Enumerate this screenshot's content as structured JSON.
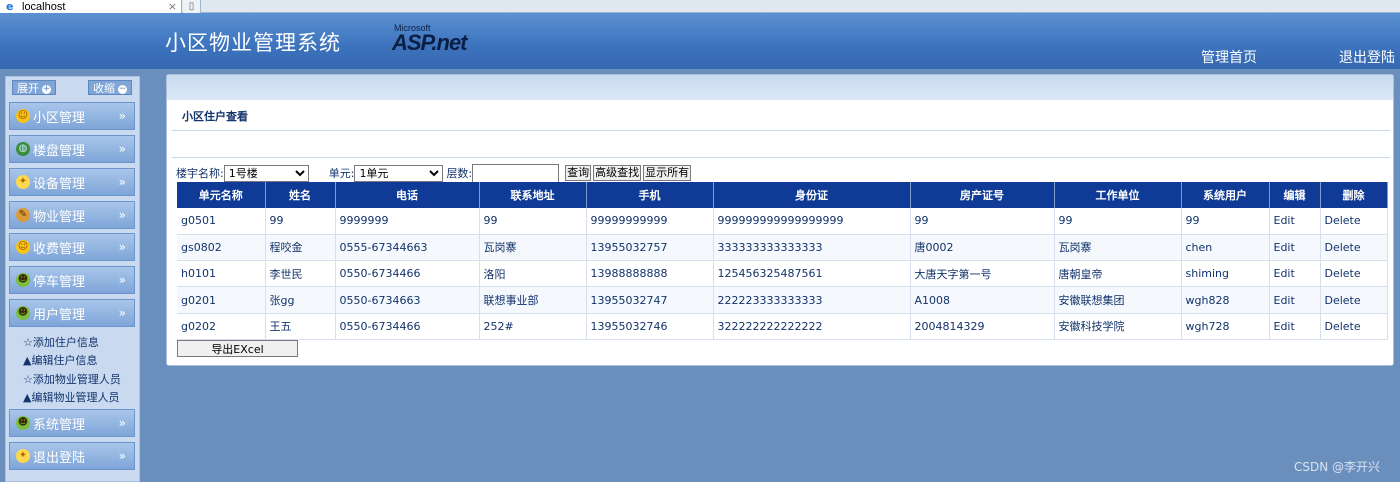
{
  "browser": {
    "tab_title": "localhost",
    "close_glyph": "×",
    "new_tab_glyph": "▯"
  },
  "header": {
    "title": "小区物业管理系统",
    "logo_small": "Microsoft",
    "logo_main": "ASP.net",
    "nav_home": "管理首页",
    "nav_logout": "退出登陆"
  },
  "sidebar": {
    "expand_label": "展开",
    "collapse_label": "收缩",
    "menu": [
      {
        "label": "小区管理",
        "icon": "community-icon"
      },
      {
        "label": "楼盘管理",
        "icon": "globe-icon"
      },
      {
        "label": "设备管理",
        "icon": "bulb-icon"
      },
      {
        "label": "物业管理",
        "icon": "tools-icon"
      },
      {
        "label": "收费管理",
        "icon": "coin-icon"
      },
      {
        "label": "停车管理",
        "icon": "users-icon"
      },
      {
        "label": "用户管理",
        "icon": "users-icon"
      },
      {
        "label": "系统管理",
        "icon": "users-icon"
      },
      {
        "label": "退出登陆",
        "icon": "bulb-icon"
      }
    ],
    "submenu": [
      "☆添加住户信息",
      "▲编辑住户信息",
      "☆添加物业管理人员",
      "▲编辑物业管理人员"
    ]
  },
  "main": {
    "section_title": "小区住户查看",
    "filters": {
      "building_label": "楼宇名称:",
      "building_value": "1号楼",
      "unit_label": "单元:",
      "unit_value": "1单元",
      "floor_label": "层数:",
      "floor_value": "",
      "query_btn": "查询",
      "advanced_btn": "高级查找",
      "show_all_btn": "显示所有"
    },
    "table": {
      "columns": [
        "单元名称",
        "姓名",
        "电话",
        "联系地址",
        "手机",
        "身份证",
        "房产证号",
        "工作单位",
        "系统用户",
        "编辑",
        "删除"
      ],
      "rows": [
        [
          "g0501",
          "99",
          "9999999",
          "99",
          "99999999999",
          "999999999999999999",
          "99",
          "99",
          "99",
          "Edit",
          "Delete"
        ],
        [
          "gs0802",
          "程咬金",
          "0555-67344663",
          "瓦岗寨",
          "13955032757",
          "333333333333333",
          "唐0002",
          "瓦岗寨",
          "chen",
          "Edit",
          "Delete"
        ],
        [
          "h0101",
          "李世民",
          "0550-6734466",
          "洛阳",
          "13988888888",
          "125456325487561",
          "大唐天字第一号",
          "唐朝皇帝",
          "shiming",
          "Edit",
          "Delete"
        ],
        [
          "g0201",
          "张gg",
          "0550-6734663",
          "联想事业部",
          "13955032747",
          "222223333333333",
          "A1008",
          "安徽联想集团",
          "wgh828",
          "Edit",
          "Delete"
        ],
        [
          "g0202",
          "王五",
          "0550-6734466",
          "252#",
          "13955032746",
          "322222222222222",
          "2004814329",
          "安徽科技学院",
          "wgh728",
          "Edit",
          "Delete"
        ]
      ]
    },
    "export_btn": "导出EXcel"
  },
  "watermark": "CSDN @李开兴",
  "colors": {
    "header": "#3c73bd",
    "table_header": "#0f3b96",
    "page_bg": "#6a8fbd"
  }
}
